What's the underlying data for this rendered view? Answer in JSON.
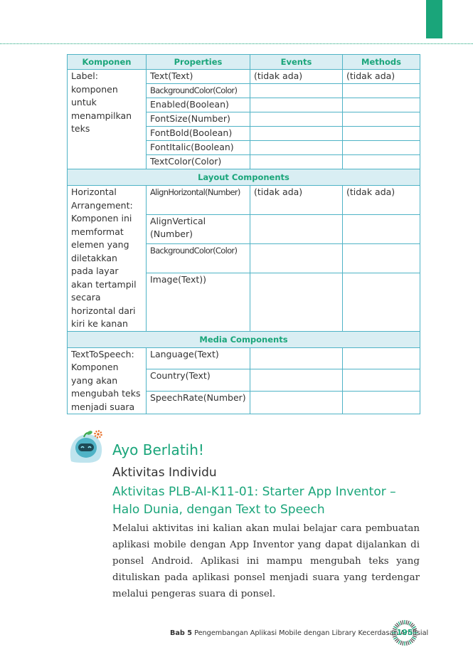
{
  "table": {
    "headers": [
      "Komponen",
      "Properties",
      "Events",
      "Methods"
    ],
    "label": {
      "component": "Label: komponen untuk menampilkan teks",
      "properties": [
        "Text(Text)",
        "BackgroundColor(Color)",
        "Enabled(Boolean)",
        "FontSize(Number)",
        "FontBold(Boolean)",
        "FontItalic(Boolean)",
        "TextColor(Color)"
      ],
      "event": "(tidak ada)",
      "method": "(tidak ada)"
    },
    "section_layout": "Layout Components",
    "horizontal": {
      "component": "Horizontal Arrangement: Komponen ini memformat elemen yang diletakkan pada layar akan tertampil secara horizontal dari kiri ke kanan",
      "properties": [
        "AlignHorizontal(Number)",
        "AlignVertical",
        "(Number)",
        "BackgroundColor(Color)",
        "Image(Text))"
      ],
      "event": "(tidak ada)",
      "method": "(tidak ada)"
    },
    "section_media": "Media Components",
    "tts": {
      "component": "TextToSpeech: Komponen yang akan mengubah teks menjadi suara",
      "properties": [
        "Language(Text)",
        "Country(Text)",
        "SpeechRate(Number)"
      ]
    }
  },
  "activity": {
    "heading": "Ayo Berlatih!",
    "subheading": "Aktivitas Individu",
    "title": "Aktivitas PLB-AI-K11-01: Starter App Inventor – Halo Dunia, dengan Text to Speech",
    "body": "Melalui aktivitas ini kalian akan mulai belajar cara pembuatan aplikasi mobile dengan App Inventor yang dapat dijalankan di ponsel Android. Aplikasi ini mampu mengubah teks yang dituliskan pada aplikasi ponsel menjadi suara yang terdengar melalui pengeras suara di ponsel."
  },
  "footer": {
    "chapter": "Bab 5",
    "text": "Pengembangan Aplikasi Mobile dengan Library Kecerdasan Artifisial",
    "page": "195"
  },
  "colors": {
    "accent": "#1aa57a",
    "table_border": "#4fb3c6",
    "header_bg": "#d9eef3"
  },
  "icons": [
    "robot-mascot-icon",
    "gear-icon",
    "page-badge-icon"
  ]
}
